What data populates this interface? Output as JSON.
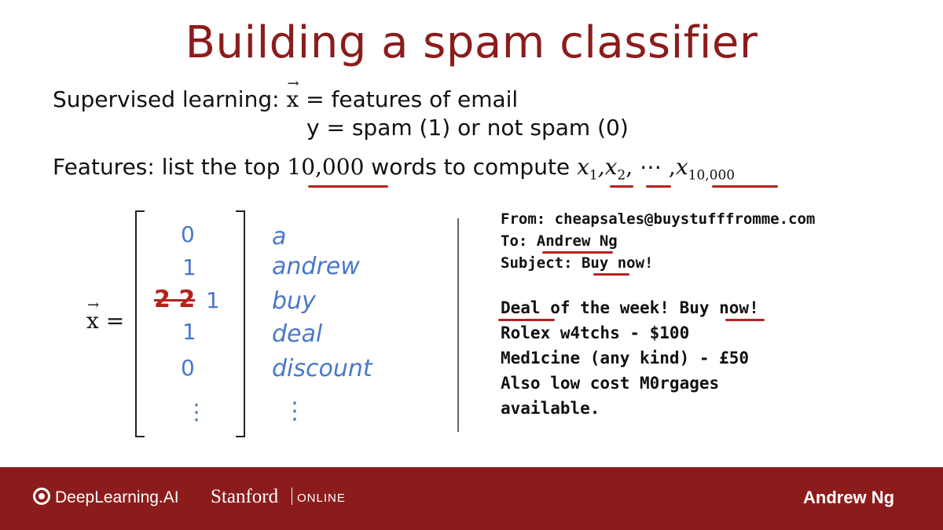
{
  "title": "Building a spam classifier",
  "supervised": {
    "label": "Supervised learning:",
    "x_symbol": "x",
    "arrow": "→",
    "x_def": "= features of email",
    "y_def": "y = spam (1) or not spam (0)"
  },
  "features": {
    "label": "Features: list the top",
    "count": "10,000",
    "rest": "words to compute",
    "x1": "x",
    "x1_sub": "1",
    "x2": "x",
    "x2_sub": "2",
    "dots": ", ⋯ ,",
    "xn": "x",
    "xn_sub": "10,000"
  },
  "vector": {
    "lhs": "x",
    "equals": "=",
    "values": [
      "0",
      "1",
      "1",
      "1",
      "0",
      "⋮"
    ],
    "scratched": "2 2",
    "words": [
      "a",
      "andrew",
      "buy",
      "deal",
      "discount",
      "⋮"
    ]
  },
  "email": {
    "from": "From: cheapsales@buystufffromme.com",
    "to": "To: Andrew Ng",
    "subject": "Subject: Buy now!",
    "body": [
      "Deal of the week! Buy now!",
      "Rolex w4tchs - $100",
      "Med1cine (any kind) - £50",
      "Also low cost M0rgages",
      "available."
    ]
  },
  "footer": {
    "brand": "DeepLearning.AI",
    "stanford": "Stanford",
    "online": "ONLINE",
    "presenter": "Andrew Ng"
  },
  "colors": {
    "title": "#8c1c1c",
    "underline": "#b3231e",
    "handwriting": "#4a78c9",
    "footer_bg": "#8c1c1c"
  }
}
